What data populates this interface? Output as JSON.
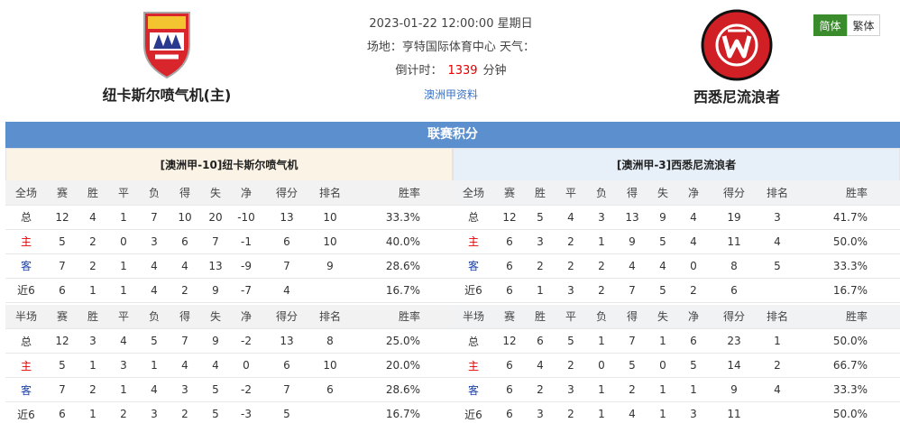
{
  "match": {
    "datetime": "2023-01-22 12:00:00 星期日",
    "venue_label": "场地：亨特国际体育中心 天气：",
    "countdown_label": "倒计时：",
    "countdown_value": "1339",
    "countdown_unit": "分钟",
    "league_link": "澳洲甲资料"
  },
  "home_team": {
    "name": "纽卡斯尔喷气机(主)"
  },
  "away_team": {
    "name": "西悉尼流浪者"
  },
  "lang": {
    "simplified": "简体",
    "traditional": "繁体"
  },
  "section_title": "联赛积分",
  "colors": {
    "title_bar": "#5b8fcd",
    "lang_active": "#3a8b2c",
    "home_label": "#e00000",
    "away_label": "#1a3fa8"
  },
  "home_panel": {
    "title": "[澳洲甲-10]纽卡斯尔喷气机",
    "full": {
      "headers": [
        "全场",
        "赛",
        "胜",
        "平",
        "负",
        "得",
        "失",
        "净",
        "得分",
        "排名",
        "胜率"
      ],
      "rows": [
        [
          "总",
          "12",
          "4",
          "1",
          "7",
          "10",
          "20",
          "-10",
          "13",
          "10",
          "33.3%"
        ],
        [
          "主",
          "5",
          "2",
          "0",
          "3",
          "6",
          "7",
          "-1",
          "6",
          "10",
          "40.0%"
        ],
        [
          "客",
          "7",
          "2",
          "1",
          "4",
          "4",
          "13",
          "-9",
          "7",
          "9",
          "28.6%"
        ],
        [
          "近6",
          "6",
          "1",
          "1",
          "4",
          "2",
          "9",
          "-7",
          "4",
          "",
          "16.7%"
        ]
      ]
    },
    "half": {
      "headers": [
        "半场",
        "赛",
        "胜",
        "平",
        "负",
        "得",
        "失",
        "净",
        "得分",
        "排名",
        "胜率"
      ],
      "rows": [
        [
          "总",
          "12",
          "3",
          "4",
          "5",
          "7",
          "9",
          "-2",
          "13",
          "8",
          "25.0%"
        ],
        [
          "主",
          "5",
          "1",
          "3",
          "1",
          "4",
          "4",
          "0",
          "6",
          "10",
          "20.0%"
        ],
        [
          "客",
          "7",
          "2",
          "1",
          "4",
          "3",
          "5",
          "-2",
          "7",
          "6",
          "28.6%"
        ],
        [
          "近6",
          "6",
          "1",
          "2",
          "3",
          "2",
          "5",
          "-3",
          "5",
          "",
          "16.7%"
        ]
      ]
    }
  },
  "away_panel": {
    "title": "[澳洲甲-3]西悉尼流浪者",
    "full": {
      "headers": [
        "全场",
        "赛",
        "胜",
        "平",
        "负",
        "得",
        "失",
        "净",
        "得分",
        "排名",
        "胜率"
      ],
      "rows": [
        [
          "总",
          "12",
          "5",
          "4",
          "3",
          "13",
          "9",
          "4",
          "19",
          "3",
          "41.7%"
        ],
        [
          "主",
          "6",
          "3",
          "2",
          "1",
          "9",
          "5",
          "4",
          "11",
          "4",
          "50.0%"
        ],
        [
          "客",
          "6",
          "2",
          "2",
          "2",
          "4",
          "4",
          "0",
          "8",
          "5",
          "33.3%"
        ],
        [
          "近6",
          "6",
          "1",
          "3",
          "2",
          "7",
          "5",
          "2",
          "6",
          "",
          "16.7%"
        ]
      ]
    },
    "half": {
      "headers": [
        "半场",
        "赛",
        "胜",
        "平",
        "负",
        "得",
        "失",
        "净",
        "得分",
        "排名",
        "胜率"
      ],
      "rows": [
        [
          "总",
          "12",
          "6",
          "5",
          "1",
          "7",
          "1",
          "6",
          "23",
          "1",
          "50.0%"
        ],
        [
          "主",
          "6",
          "4",
          "2",
          "0",
          "5",
          "0",
          "5",
          "14",
          "2",
          "66.7%"
        ],
        [
          "客",
          "6",
          "2",
          "3",
          "1",
          "2",
          "1",
          "1",
          "9",
          "4",
          "33.3%"
        ],
        [
          "近6",
          "6",
          "3",
          "2",
          "1",
          "4",
          "1",
          "3",
          "11",
          "",
          "50.0%"
        ]
      ]
    }
  }
}
